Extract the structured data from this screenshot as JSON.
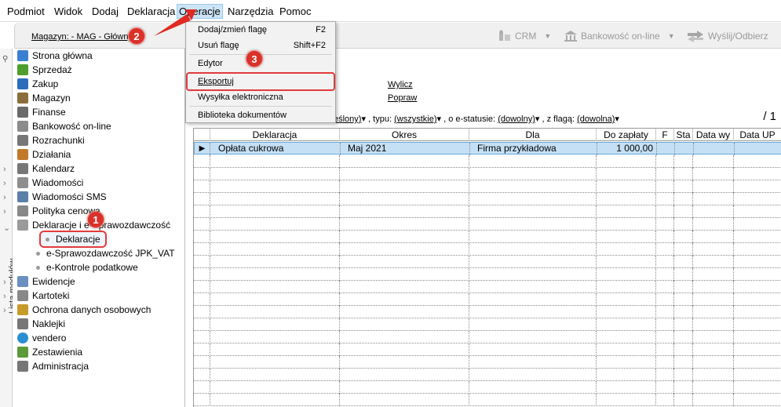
{
  "menubar": {
    "items": [
      "Podmiot",
      "Widok",
      "Dodaj",
      "Deklaracja",
      "Operacje",
      "Narzędzia",
      "Pomoc"
    ],
    "active_index": 4
  },
  "toolbar": {
    "warehouse_label": "Magazyn: - MAG - Główny",
    "crm": "CRM",
    "banking": "Bankowość on-line",
    "send_receive": "Wyślij/Odbierz"
  },
  "sidetab": {
    "label": "Lista modułów"
  },
  "tree": {
    "items": [
      {
        "label": "Strona główna",
        "color": "#3b7fd1"
      },
      {
        "label": "Sprzedaż",
        "color": "#4f9d2b"
      },
      {
        "label": "Zakup",
        "color": "#2b6dbb"
      },
      {
        "label": "Magazyn",
        "color": "#8a6d3b"
      },
      {
        "label": "Finanse",
        "color": "#6a6a6a"
      },
      {
        "label": "Bankowość on-line",
        "color": "#8b8b8b"
      },
      {
        "label": "Rozrachunki",
        "color": "#777777"
      },
      {
        "label": "Działania",
        "color": "#c07a2a"
      },
      {
        "label": "Kalendarz",
        "color": "#777777"
      },
      {
        "label": "Wiadomości",
        "color": "#8e8e8e"
      },
      {
        "label": "Wiadomości SMS",
        "color": "#5a7fa8"
      },
      {
        "label": "Polityka cenowa",
        "color": "#888888"
      },
      {
        "label": "Deklaracje i e-Sprawozdawczość",
        "color": "#9a9a9a"
      }
    ],
    "subitems": [
      "Deklaracje",
      "e-Sprawozdawczość JPK_VAT",
      "e-Kontrole podatkowe"
    ],
    "items_after": [
      {
        "label": "Ewidencje",
        "color": "#6a8fc0"
      },
      {
        "label": "Kartoteki",
        "color": "#888888"
      },
      {
        "label": "Ochrona danych osobowych",
        "color": "#c79a2a"
      },
      {
        "label": "Naklejki",
        "color": "#777777"
      },
      {
        "label": "vendero",
        "color": "#2a8fd1"
      },
      {
        "label": "Zestawienia",
        "color": "#5a9a3a"
      },
      {
        "label": "Administracja",
        "color": "#777777"
      }
    ]
  },
  "content": {
    "link_wylicz": "Wylicz",
    "link_popraw": "Popraw",
    "filter": {
      "first_value": "eślony)",
      "typu_label": ", typu:",
      "typu_value": "(wszystkie)",
      "estatus_label": ", o e-statusie:",
      "estatus_value": "(dowolny)",
      "flag_label": ", z flagą:",
      "flag_value": "(dowolna)"
    },
    "page_count": "/ 1"
  },
  "grid": {
    "columns": [
      "Deklaracja",
      "Okres",
      "Dla",
      "Do zapłaty",
      "F",
      "Sta",
      "Data wy",
      "Data UP"
    ],
    "rows": [
      [
        "Opłata cukrowa",
        "Maj 2021",
        "Firma przykładowa",
        "1 000,00",
        "",
        "",
        "",
        ""
      ]
    ]
  },
  "menu": {
    "items": [
      {
        "label": "Dodaj/zmień flagę",
        "shortcut": "F2"
      },
      {
        "label": "Usuń flagę",
        "shortcut": "Shift+F2"
      },
      {
        "label": "Edytor",
        "shortcut": ""
      },
      {
        "label": "Eksportuj",
        "shortcut": ""
      },
      {
        "label": "Wysyłka elektroniczna",
        "shortcut": ""
      },
      {
        "label": "Biblioteka dokumentów",
        "shortcut": ""
      }
    ]
  },
  "badges": [
    "1",
    "2",
    "3"
  ],
  "colors": {
    "highlight": "#e23b3b",
    "selection": "#c5e0f5",
    "menu_active": "#cce4f7"
  }
}
